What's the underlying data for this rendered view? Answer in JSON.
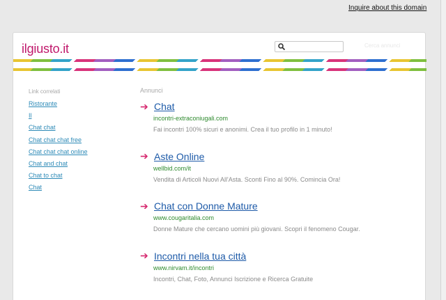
{
  "header": {
    "inquire_link": "Inquire about this domain"
  },
  "site": {
    "logo": "ilgiusto.it"
  },
  "search": {
    "value": "",
    "placeholder": "",
    "button_label": "Cerca annunci"
  },
  "sidebar": {
    "title": "Link correlati",
    "items": [
      {
        "label": "Ristorante"
      },
      {
        "label": "Il"
      },
      {
        "label": "Chat chat"
      },
      {
        "label": "Chat chat chat free"
      },
      {
        "label": "Chat chat chat online"
      },
      {
        "label": "Chat and chat"
      },
      {
        "label": "Chat to chat"
      },
      {
        "label": "Chat"
      }
    ]
  },
  "ads": {
    "title": "Annunci",
    "items": [
      {
        "title": "Chat",
        "url": "incontri-extraconiugali.com",
        "desc": "Fai incontri 100% sicuri e anonimi. Crea il tuo profilo in 1 minuto!"
      },
      {
        "title": "Aste Online",
        "url": "wellbid.com/it",
        "desc": "Vendita di Articoli Nuovi All'Asta. Sconti Fino al 90%. Comincia Ora!"
      },
      {
        "title": "Chat con Donne Mature",
        "url": "www.cougaritalia.com",
        "desc": "Donne Mature che cercano uomini più giovani. Scopri il fenomeno Cougar."
      },
      {
        "title": "Incontri nella tua città",
        "url": "www.nirvam.it/incontri",
        "desc": "Incontri, Chat, Foto, Annunci Iscrizione e Ricerca Gratuite"
      }
    ]
  },
  "colors": {
    "logo": "#c0186b",
    "link": "#2d8ab7",
    "ad_title": "#1d5aa8",
    "ad_url": "#2e8a2e",
    "arrow": "#d6276e"
  }
}
